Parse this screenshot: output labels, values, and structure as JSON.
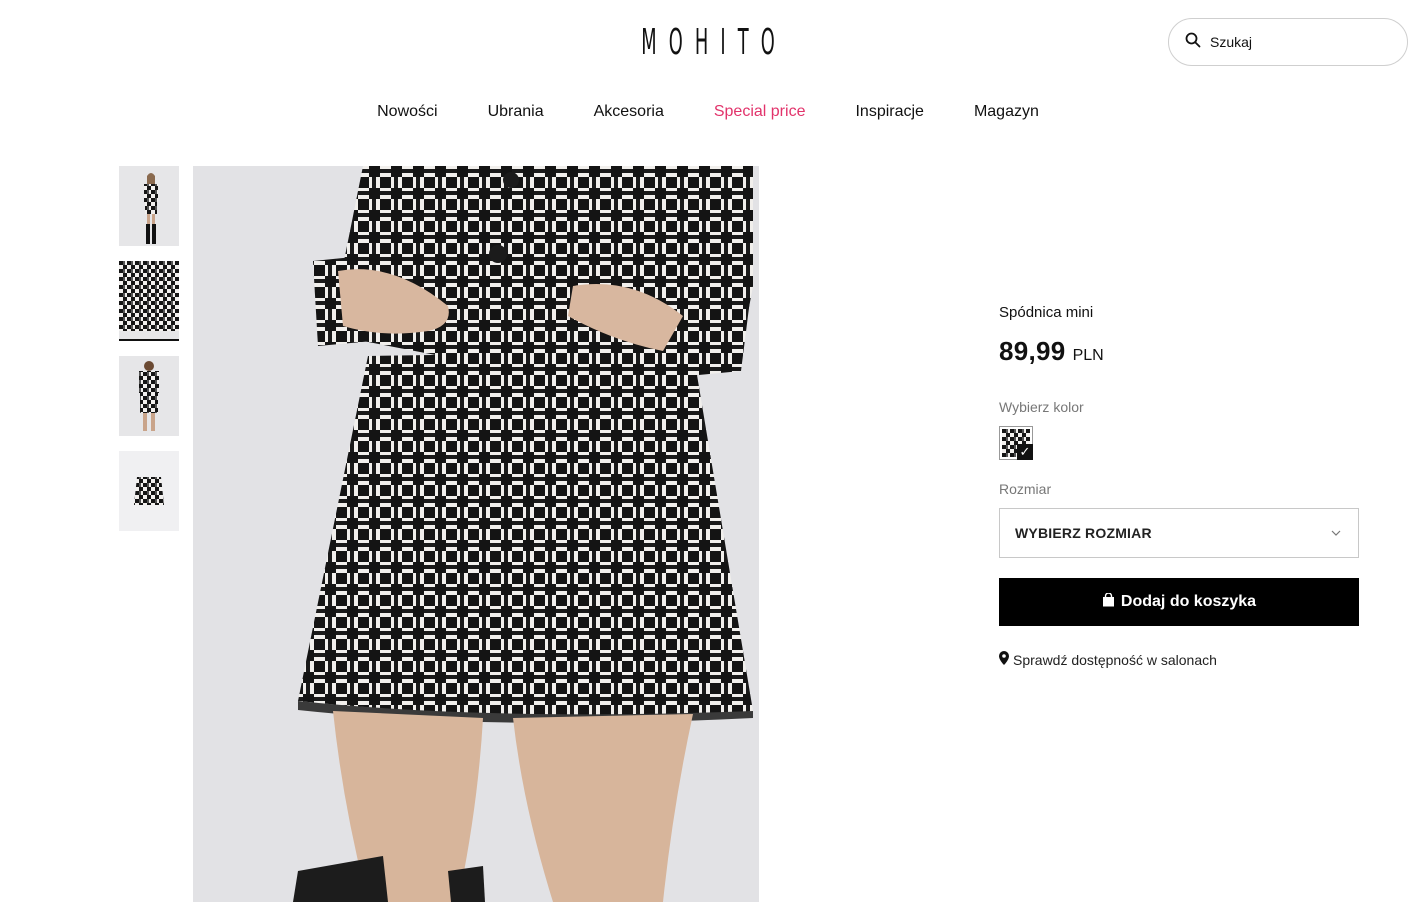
{
  "header": {
    "logo": "MOHITO",
    "search_placeholder": "Szukaj"
  },
  "nav": {
    "items": [
      "Nowości",
      "Ubrania",
      "Akcesoria",
      "Special price",
      "Inspiracje",
      "Magazyn"
    ],
    "highlight_color": "#e2336b"
  },
  "gallery": {
    "thumbnails": [
      "full-outfit-front",
      "skirt-detail",
      "full-outfit-back",
      "skirt-flat"
    ],
    "active_index": 1
  },
  "product": {
    "title": "Spódnica mini",
    "price": "89,99",
    "currency": "PLN",
    "color_label": "Wybierz kolor",
    "size_label": "Rozmiar",
    "size_select_value": "WYBIERZ ROZMIAR",
    "add_to_cart": "Dodaj do koszyka",
    "store_check": "Sprawdź dostępność w salonach"
  },
  "colors": {
    "accent": "#e2336b",
    "button_bg": "#000000"
  }
}
